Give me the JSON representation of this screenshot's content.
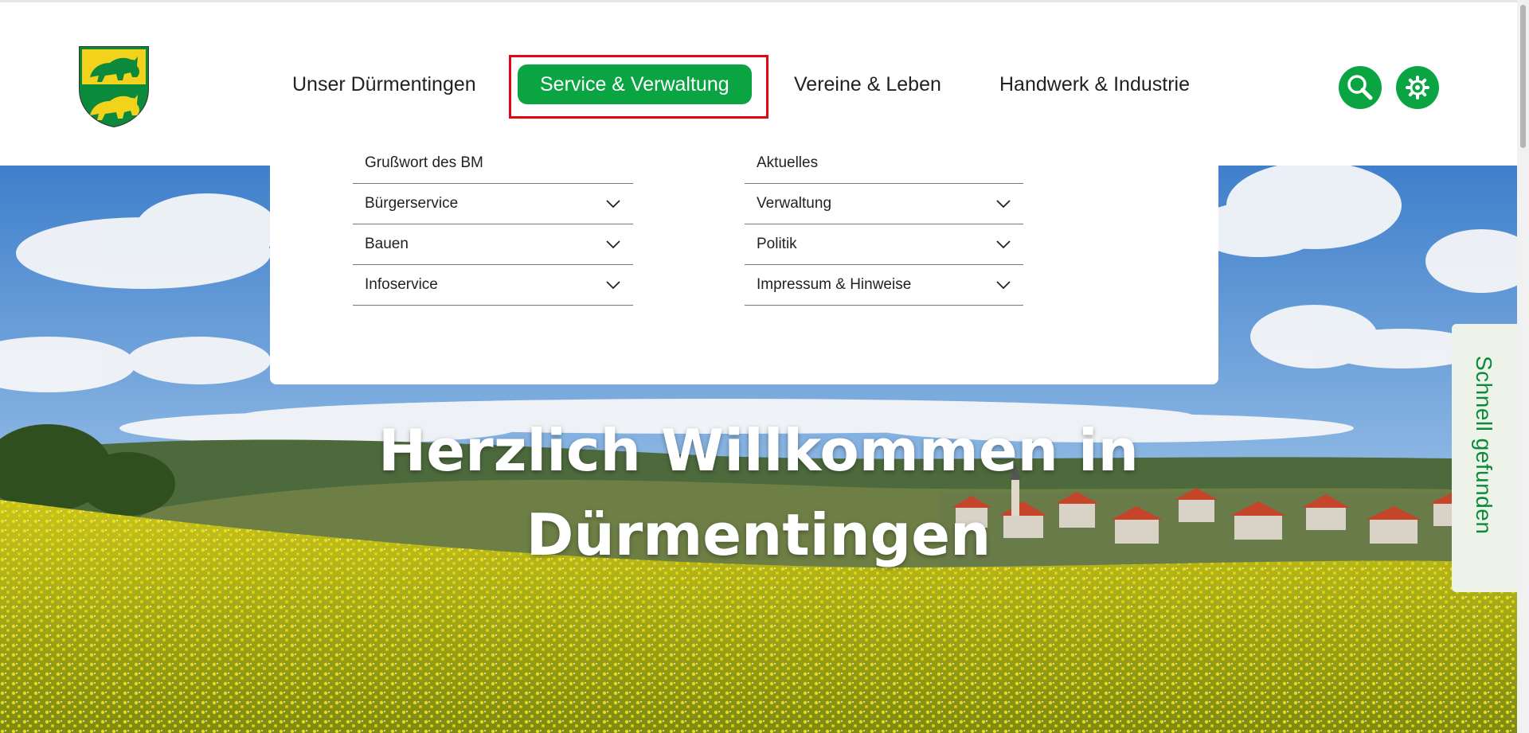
{
  "nav": {
    "items": [
      {
        "label": "Unser Dürmentingen"
      },
      {
        "label": "Service & Verwaltung",
        "active": true
      },
      {
        "label": "Vereine & Leben"
      },
      {
        "label": "Handwerk & Industrie"
      }
    ],
    "search_icon": "search-icon",
    "settings_icon": "gear-icon"
  },
  "dropdown": {
    "left_column": [
      {
        "label": "Grußwort des BM",
        "expandable": false
      },
      {
        "label": "Bürgerservice",
        "expandable": true
      },
      {
        "label": "Bauen",
        "expandable": true
      },
      {
        "label": "Infoservice",
        "expandable": true
      }
    ],
    "right_column": [
      {
        "label": "Aktuelles",
        "expandable": false
      },
      {
        "label": "Verwaltung",
        "expandable": true
      },
      {
        "label": "Politik",
        "expandable": true
      },
      {
        "label": "Impressum & Hinweise",
        "expandable": true
      }
    ]
  },
  "hero": {
    "title_line1": "Herzlich Willkommen in",
    "title_line2": "Dürmentingen"
  },
  "side_tab": {
    "label": "Schnell gefunden"
  },
  "colors": {
    "accent": "#0aa542",
    "highlight_border": "#e30613",
    "coat_yellow": "#f3d21b",
    "coat_green": "#0a8a3a"
  }
}
